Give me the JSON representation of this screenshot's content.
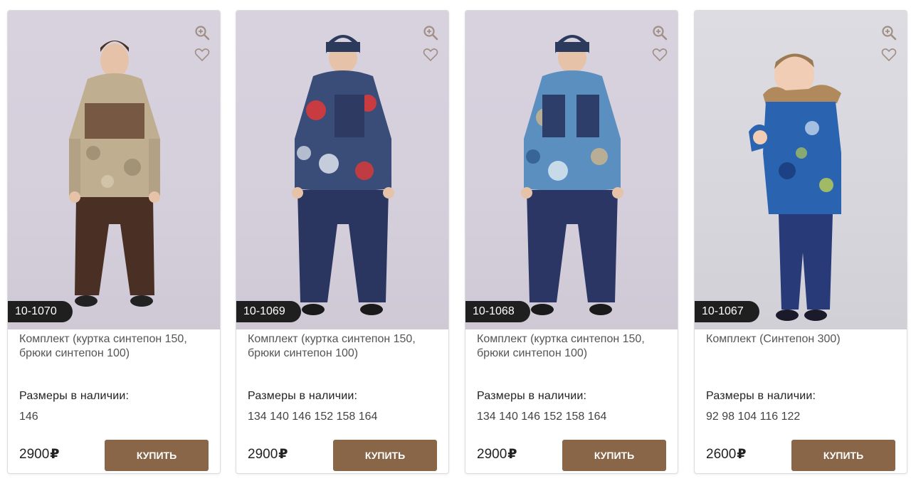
{
  "products": [
    {
      "sku": "10-1070",
      "title": "Комплект (куртка синтепон 150, брюки синтепон 100)",
      "sizes_label": "Размеры в наличии:",
      "sizes": "146",
      "price": "2900",
      "currency": "₽",
      "buy_label": "КУПИТЬ",
      "jacket_color": "#b8a88c",
      "pants_color": "#4a2f24",
      "hat": false
    },
    {
      "sku": "10-1069",
      "title": "Комплект (куртка синтепон 150, брюки синтепон 100)",
      "sizes_label": "Размеры в наличии:",
      "sizes": "134 140 146 152 158 164",
      "price": "2900",
      "currency": "₽",
      "buy_label": "КУПИТЬ",
      "jacket_color": "#3a4c78",
      "pants_color": "#2a3560",
      "hat": true
    },
    {
      "sku": "10-1068",
      "title": "Комплект (куртка синтепон 150, брюки синтепон 100)",
      "sizes_label": "Размеры в наличии:",
      "sizes": "134 140 146 152 158 164",
      "price": "2900",
      "currency": "₽",
      "buy_label": "КУПИТЬ",
      "jacket_color": "#5b8fbf",
      "pants_color": "#2c3664",
      "hat": true
    },
    {
      "sku": "10-1067",
      "title": "Комплект (Синтепон 300)",
      "sizes_label": "Размеры в наличии:",
      "sizes": "92 98 104 116 122",
      "price": "2600",
      "currency": "₽",
      "buy_label": "КУПИТЬ",
      "jacket_color": "#2a64b0",
      "pants_color": "#283a78",
      "hat": false
    }
  ],
  "colors": {
    "button": "#8a6649",
    "badge": "#1f1f1f",
    "icon": "#a08f85"
  }
}
